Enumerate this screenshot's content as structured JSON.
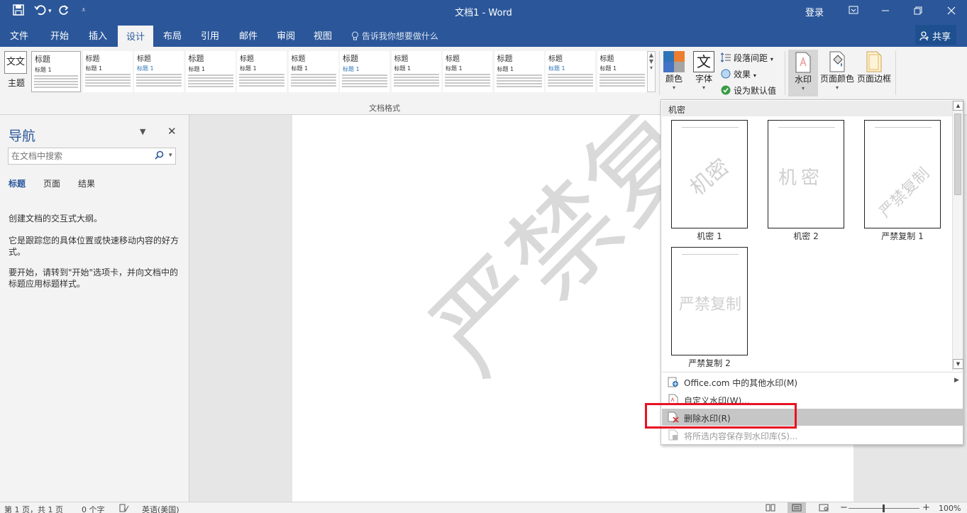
{
  "titlebar": {
    "title": "文档1  -  Word",
    "login": "登录",
    "icons": [
      "save-icon",
      "undo-icon",
      "redo-icon",
      "customize-qat-icon",
      "ribbon-display-icon",
      "minimize-icon",
      "restore-icon",
      "close-icon"
    ]
  },
  "tabs": [
    "文件",
    "开始",
    "插入",
    "设计",
    "布局",
    "引用",
    "邮件",
    "审阅",
    "视图"
  ],
  "active_tab": "设计",
  "tellme": "告诉我你想要做什么",
  "share": "共享",
  "ribbon": {
    "theme_label": "主题",
    "theme_icon_text": "文文",
    "group_label": "文档格式",
    "gallery": [
      {
        "title": "标题",
        "h1": "标题 1"
      },
      {
        "title": "标题",
        "h1": "标题 1"
      },
      {
        "title": "标题",
        "h1": "标题 1"
      },
      {
        "title": "标题",
        "h1": "标题 1"
      },
      {
        "title": "标题",
        "h1": "标题 1"
      },
      {
        "title": "标题",
        "h1": "标题 1"
      },
      {
        "title": "标题",
        "h1": "标题 1"
      },
      {
        "title": "标题",
        "h1": "标题 1"
      },
      {
        "title": "标题",
        "h1": "标题 1"
      },
      {
        "title": "标题",
        "h1": "标题 1"
      },
      {
        "title": "标题",
        "h1": "标题 1"
      },
      {
        "title": "标题",
        "h1": "标题 1"
      }
    ],
    "colors_label": "颜色",
    "fonts_label": "字体",
    "paragraph_spacing_label": "段落间距",
    "effects_label": "效果",
    "set_default_label": "设为默认值",
    "watermark_label": "水印",
    "page_color_label": "页面颜色",
    "page_borders_label": "页面边框"
  },
  "nav": {
    "title": "导航",
    "search_placeholder": "在文档中搜索",
    "tabs": [
      "标题",
      "页面",
      "结果"
    ],
    "text1": "创建文档的交互式大纲。",
    "text2": "它是跟踪您的具体位置或快速移动内容的好方式。",
    "text3": "要开始，请转到\"开始\"选项卡，并向文档中的标题应用标题样式。"
  },
  "document": {
    "watermark_text": "严禁复制"
  },
  "watermark_panel": {
    "category": "机密",
    "thumbs": [
      {
        "caption": "机密 1",
        "text": "机密",
        "style": "diagonal"
      },
      {
        "caption": "机密 2",
        "text": "机密",
        "style": "horizontal"
      },
      {
        "caption": "严禁复制 1",
        "text": "严禁复制",
        "style": "diagonal"
      },
      {
        "caption": "严禁复制 2",
        "text": "严禁复制",
        "style": "horizontal"
      }
    ],
    "menu": {
      "more_online": "Office.com 中的其他水印(M)",
      "custom": "自定义水印(W)...",
      "remove": "删除水印(R)",
      "save_selection": "将所选内容保存到水印库(S)..."
    }
  },
  "status": {
    "page": "第 1 页，共 1 页",
    "words": "0 个字",
    "language": "英语(美国)",
    "zoom": "100%",
    "zoom_minus": "−",
    "zoom_plus": "+"
  },
  "colors": {
    "brand": "#2b579a",
    "highlight": "#e81123",
    "ribbon_bg": "#f3f3f3"
  }
}
